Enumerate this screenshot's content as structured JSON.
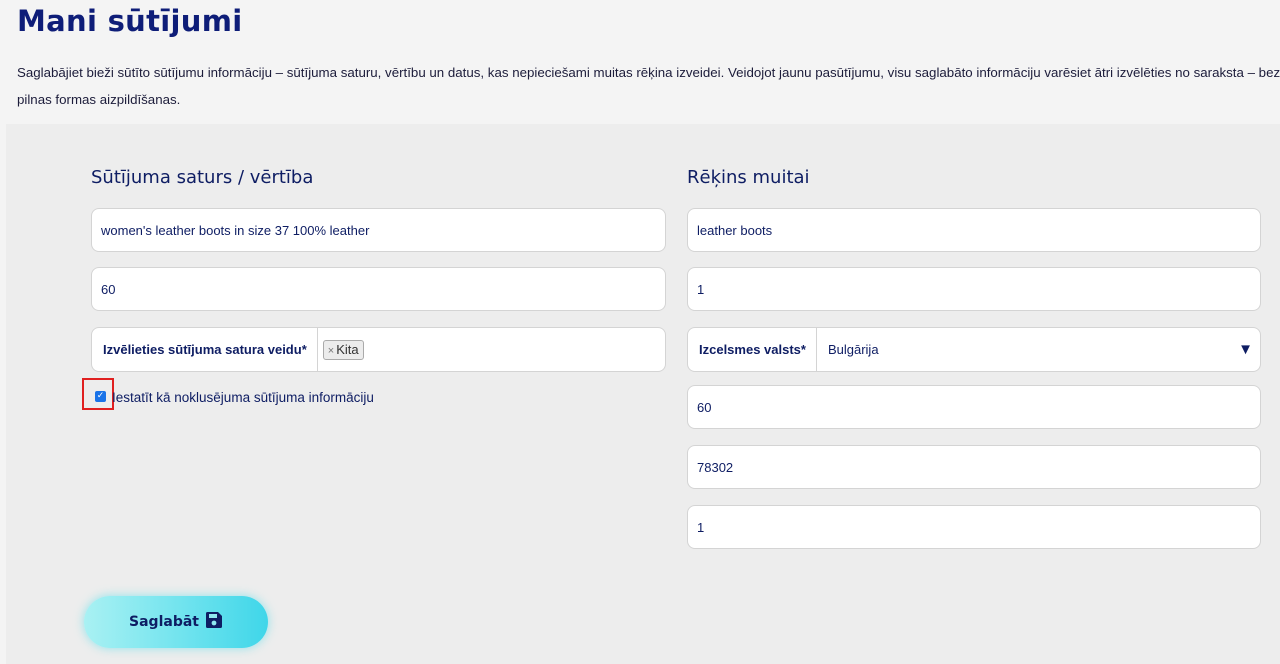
{
  "page": {
    "title": "Mani sūtījumi",
    "intro": "Saglabājiet bieži sūtīto sūtījumu informāciju – sūtījuma saturu, vērtību un datus, kas nepieciešami muitas rēķina izveidei. Veidojot jaunu pasūtījumu, visu saglabāto informāciju varēsiet ātri izvēlēties no saraksta – bez pilnas formas aizpildīšanas."
  },
  "left": {
    "title": "Sūtījuma saturs / vērtība",
    "content_value": "women's leather boots in size 37 100% leather",
    "value_value": "60",
    "type_label": "Izvēlieties sūtījuma satura veidu*",
    "type_tag": "Kita",
    "type_tag_remove": "×",
    "default_label": "Iestatīt kā noklusējuma sūtījuma informāciju",
    "default_checked": true
  },
  "right": {
    "title": "Rēķins muitai",
    "description_value": "leather boots",
    "quantity_value": "1",
    "country_label": "Izcelsmes valsts*",
    "country_value": "Bulgārija",
    "value_value": "60",
    "hs_code_value": "78302",
    "weight_value": "1"
  },
  "actions": {
    "save_label": "Saglabāt",
    "save_icon": "floppy-disk-icon"
  },
  "colors": {
    "primary_text": "#0e1d63",
    "button_gradient_start": "#a9f1f3",
    "button_gradient_end": "#3fd6e9",
    "highlight": "#e02020"
  }
}
